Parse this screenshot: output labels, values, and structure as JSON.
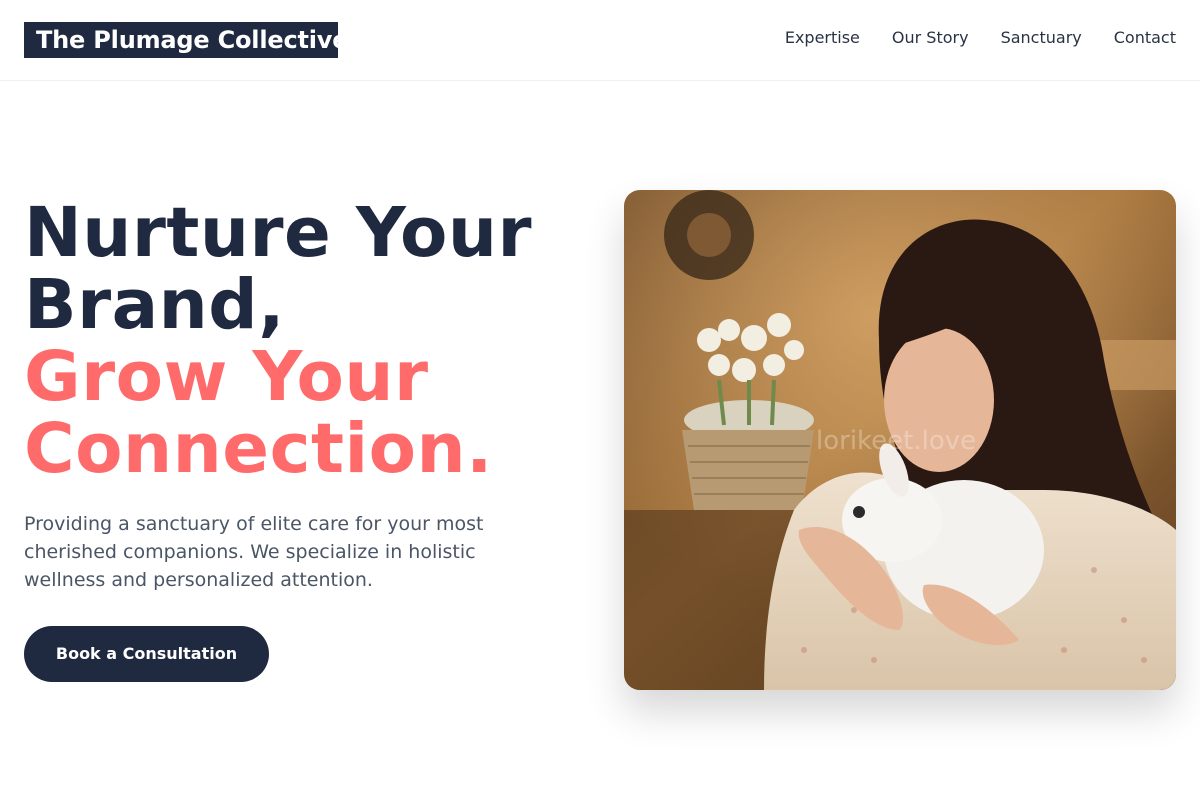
{
  "header": {
    "logo_text": "The Plumage Collective",
    "nav": [
      {
        "label": "Expertise"
      },
      {
        "label": "Our Story"
      },
      {
        "label": "Sanctuary"
      },
      {
        "label": "Contact"
      }
    ]
  },
  "hero": {
    "title_line1": "Nurture Your",
    "title_line2": "Brand,",
    "title_line3": "Grow Your",
    "title_line4": "Connection.",
    "subtitle": "Providing a sanctuary of elite care for your most cherished companions. We specialize in holistic wellness and personalized attention.",
    "cta_label": "Book a Consultation",
    "image_watermark": "lorikeet.love"
  },
  "colors": {
    "navy": "#1f2940",
    "accent": "#ff6b6b",
    "body_text": "#4a5566"
  }
}
